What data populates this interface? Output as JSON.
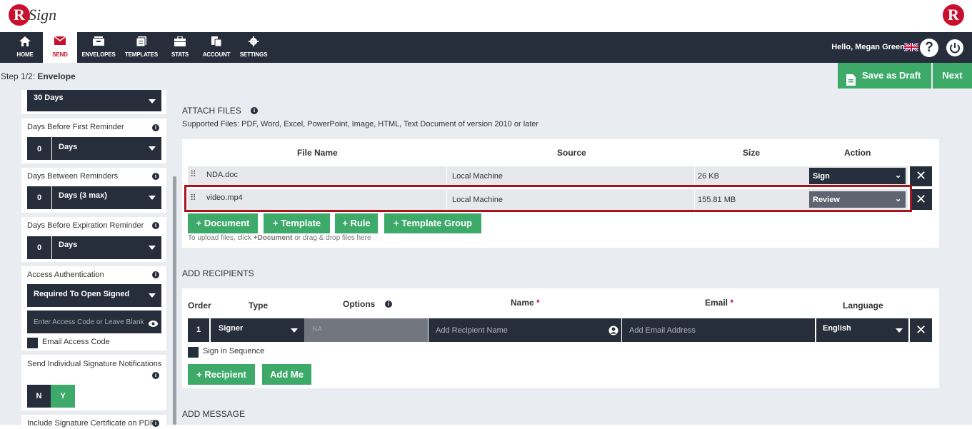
{
  "brand": {
    "logo_letter": "R",
    "logo_text": "Sign"
  },
  "nav": {
    "items": [
      {
        "label": "HOME",
        "icon": "home-icon"
      },
      {
        "label": "SEND",
        "icon": "envelope-icon"
      },
      {
        "label": "ENVELOPES",
        "icon": "inbox-icon"
      },
      {
        "label": "TEMPLATES",
        "icon": "templates-icon"
      },
      {
        "label": "STATS",
        "icon": "briefcase-icon"
      },
      {
        "label": "ACCOUNT",
        "icon": "account-icon"
      },
      {
        "label": "SETTINGS",
        "icon": "gear-icon"
      }
    ],
    "active": "SEND",
    "greeting": "Hello, Megan Greene"
  },
  "step": {
    "prefix": "Step 1/2:",
    "name": "Envelope"
  },
  "actions": {
    "save_draft": "Save as Draft",
    "next": "Next"
  },
  "left": {
    "expiry_value": "30 Days",
    "first_reminder": {
      "label": "Days Before First Reminder",
      "number": "0",
      "unit": "Days"
    },
    "between_reminders": {
      "label": "Days Between Reminders",
      "number": "0",
      "unit": "Days (3 max)"
    },
    "expiration_reminder": {
      "label": "Days Before Expiration Reminder",
      "number": "0",
      "unit": "Days"
    },
    "access_auth": {
      "label": "Access Authentication",
      "value": "Required To Open Signed",
      "placeholder": "Enter Access Code or Leave Blank",
      "email_code": "Email Access Code"
    },
    "individual_notifications": {
      "label": "Send Individual Signature Notifications",
      "no": "N",
      "yes": "Y"
    },
    "certificate": {
      "label": "Include Signature Certificate on PDF"
    }
  },
  "attach": {
    "title": "ATTACH FILES",
    "supported": "Supported Files: PDF, Word, Excel, PowerPoint, Image, HTML, Text Document of version 2010 or later",
    "headers": {
      "file": "File Name",
      "source": "Source",
      "size": "Size",
      "action": "Action"
    },
    "rows": [
      {
        "file": "NDA.doc",
        "source": "Local Machine",
        "size": "26 KB",
        "action": "Sign"
      },
      {
        "file": "video.mp4",
        "source": "Local Machine",
        "size": "155.81 MB",
        "action": "Review"
      }
    ],
    "buttons": [
      "+ Document",
      "+ Template",
      "+ Rule",
      "+ Template Group"
    ],
    "hint_prefix": "To upload files, click ",
    "hint_bold": "+Document",
    "hint_suffix": " or drag & drop files here"
  },
  "recipients": {
    "title": "ADD RECIPIENTS",
    "headers": {
      "order": "Order",
      "type": "Type",
      "options": "Options",
      "name": "Name",
      "email": "Email",
      "language": "Language",
      "required": "*"
    },
    "row": {
      "order": "1",
      "type": "Signer",
      "options": "NA",
      "name_placeholder": "Add Recipient Name",
      "email_placeholder": "Add Email Address",
      "language": "English"
    },
    "sequence": "Sign in Sequence",
    "add_recipient": "+ Recipient",
    "add_me": "Add Me"
  },
  "message": {
    "title": "ADD MESSAGE"
  },
  "colors": {
    "accent": "#c8102e",
    "navy": "#272e3b",
    "green": "#3daa6a",
    "panel": "#e9ecf0"
  }
}
